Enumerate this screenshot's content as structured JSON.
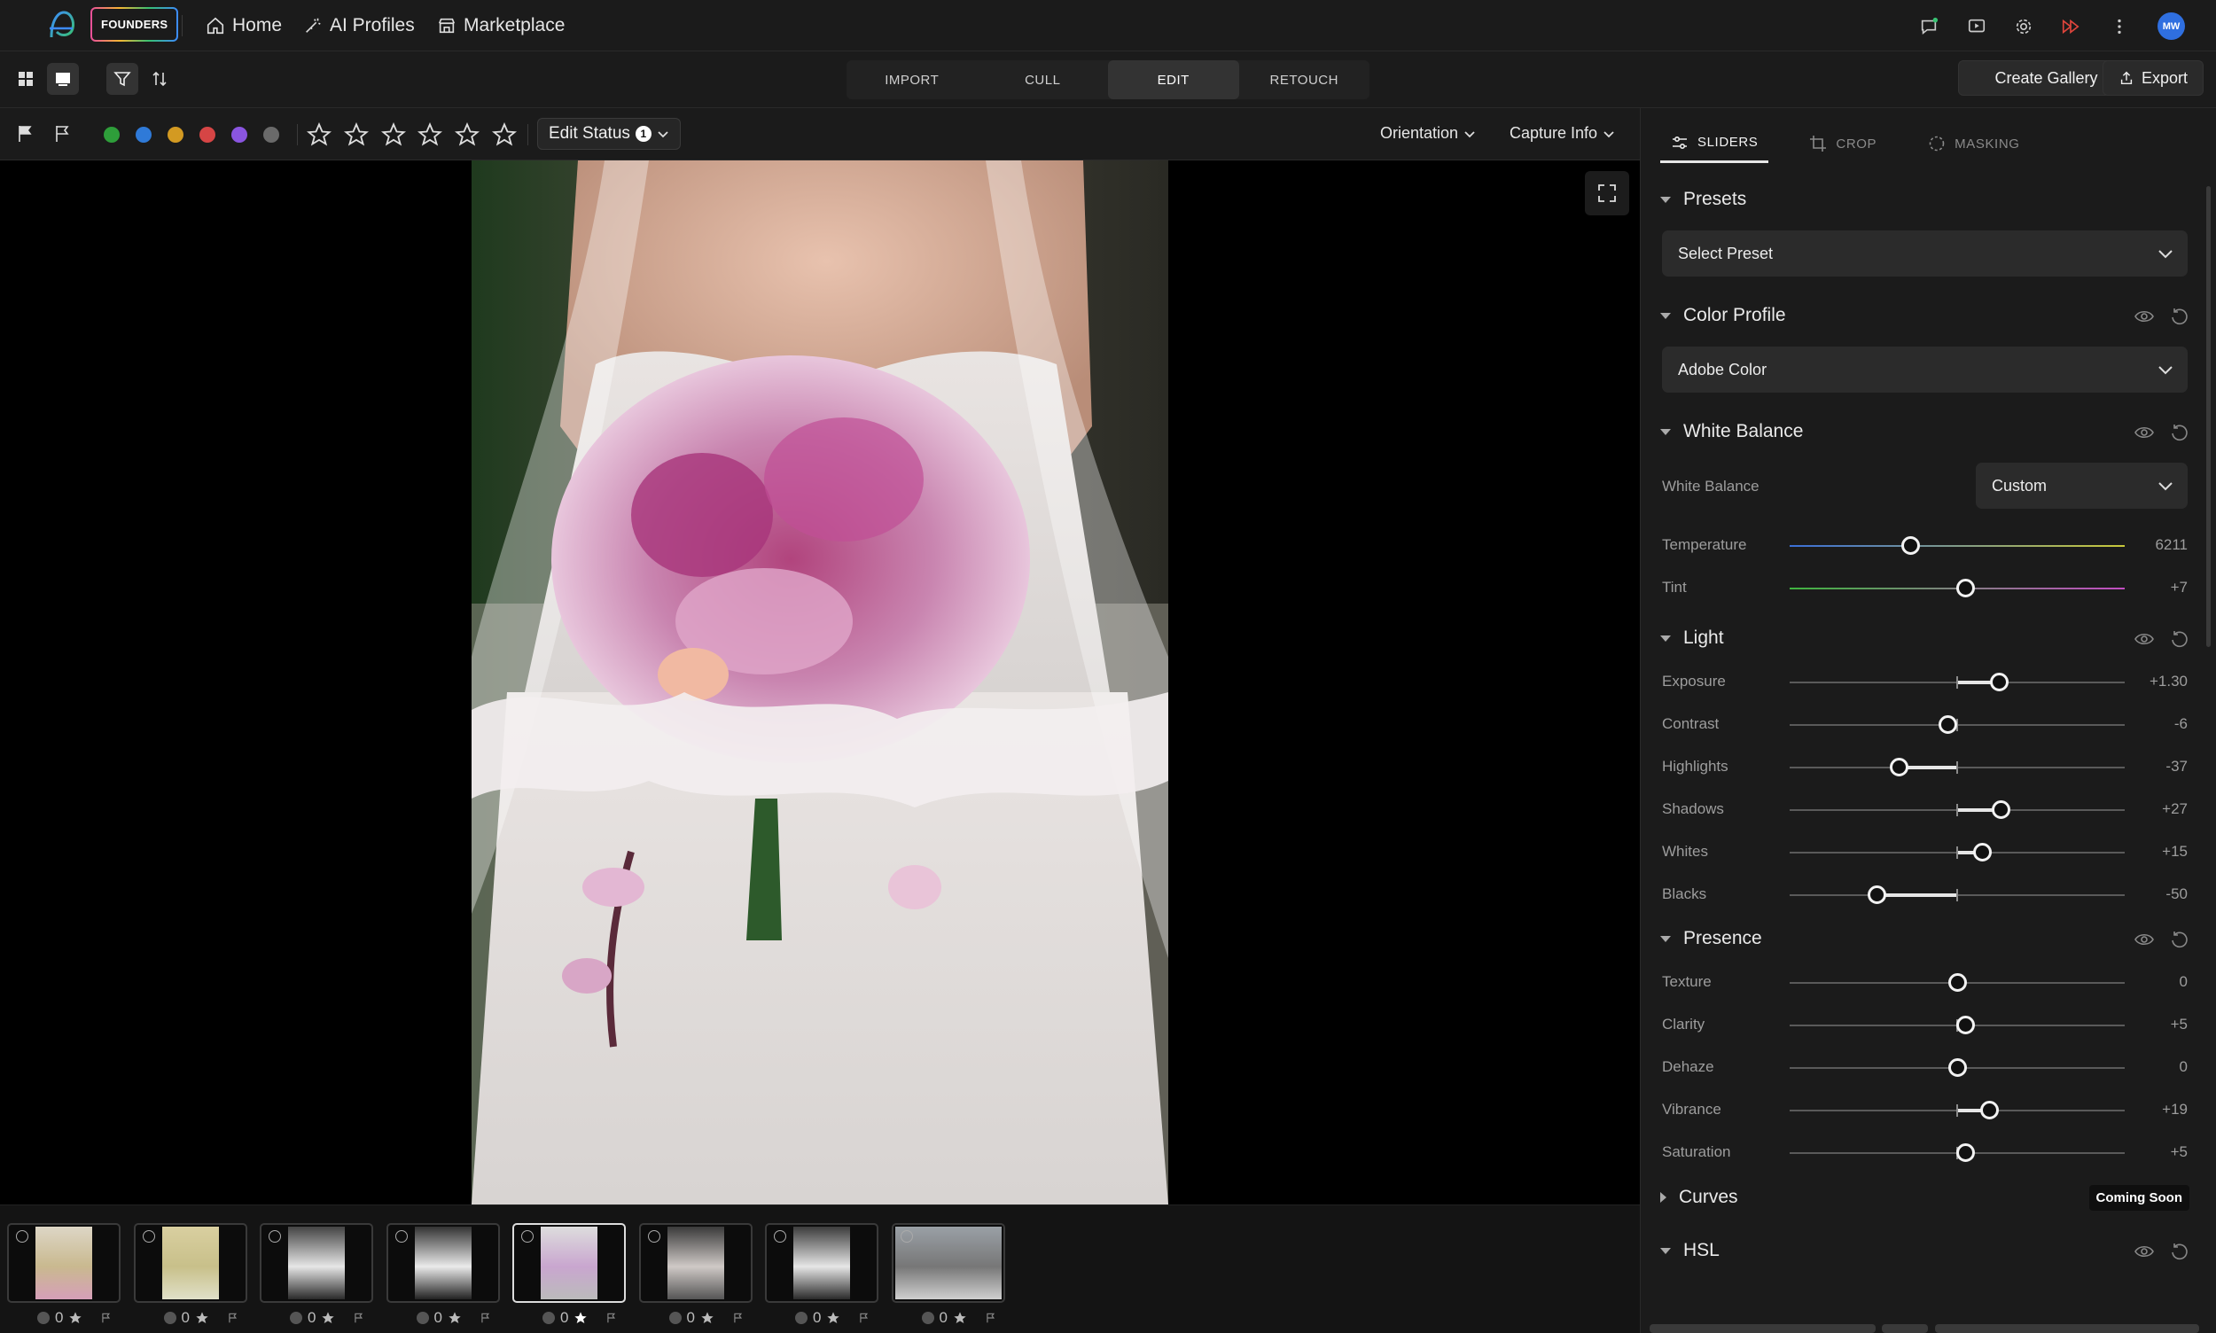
{
  "topnav": {
    "badge": "FOUNDERS",
    "links": [
      "Home",
      "AI Profiles",
      "Marketplace"
    ],
    "avatar_initials": "MW"
  },
  "toolbar": {
    "modes": [
      "IMPORT",
      "CULL",
      "EDIT",
      "RETOUCH"
    ],
    "active_mode": "EDIT",
    "create_gallery": "Create Gallery",
    "export": "Export"
  },
  "filterbar": {
    "colors": [
      "#2e9e3a",
      "#2f7ad8",
      "#d39a22",
      "#d64545",
      "#8a55e0",
      "#6a6a6a"
    ],
    "edit_status_label": "Edit Status",
    "edit_status_count": "1",
    "orientation": "Orientation",
    "capture_info": "Capture Info"
  },
  "filmstrip": {
    "items": [
      {
        "count": "0",
        "starred": false
      },
      {
        "count": "0",
        "starred": false
      },
      {
        "count": "0",
        "starred": false
      },
      {
        "count": "0",
        "starred": false
      },
      {
        "count": "0",
        "starred": true
      },
      {
        "count": "0",
        "starred": false
      },
      {
        "count": "0",
        "starred": false
      },
      {
        "count": "0",
        "starred": false
      }
    ],
    "active_index": 4
  },
  "panel": {
    "tabs": [
      "SLIDERS",
      "CROP",
      "MASKING"
    ],
    "active_tab": "SLIDERS",
    "presets": {
      "title": "Presets",
      "select": "Select Preset"
    },
    "color_profile": {
      "title": "Color Profile",
      "select": "Adobe Color"
    },
    "white_balance": {
      "title": "White Balance",
      "wb_label": "White Balance",
      "wb_value": "Custom",
      "temperature": {
        "label": "Temperature",
        "value": "6211",
        "pos": 0.36
      },
      "tint": {
        "label": "Tint",
        "value": "+7",
        "pos": 0.525
      }
    },
    "light": {
      "title": "Light",
      "rows": [
        {
          "label": "Exposure",
          "value": "+1.30",
          "pos": 0.625
        },
        {
          "label": "Contrast",
          "value": "-6",
          "pos": 0.47
        },
        {
          "label": "Highlights",
          "value": "-37",
          "pos": 0.325
        },
        {
          "label": "Shadows",
          "value": "+27",
          "pos": 0.63
        },
        {
          "label": "Whites",
          "value": "+15",
          "pos": 0.575
        },
        {
          "label": "Blacks",
          "value": "-50",
          "pos": 0.26
        }
      ]
    },
    "presence": {
      "title": "Presence",
      "rows": [
        {
          "label": "Texture",
          "value": "0",
          "pos": 0.5
        },
        {
          "label": "Clarity",
          "value": "+5",
          "pos": 0.525
        },
        {
          "label": "Dehaze",
          "value": "0",
          "pos": 0.5
        },
        {
          "label": "Vibrance",
          "value": "+19",
          "pos": 0.595
        },
        {
          "label": "Saturation",
          "value": "+5",
          "pos": 0.525
        }
      ]
    },
    "curves": {
      "title": "Curves",
      "badge": "Coming Soon"
    },
    "hsl": {
      "title": "HSL"
    }
  }
}
